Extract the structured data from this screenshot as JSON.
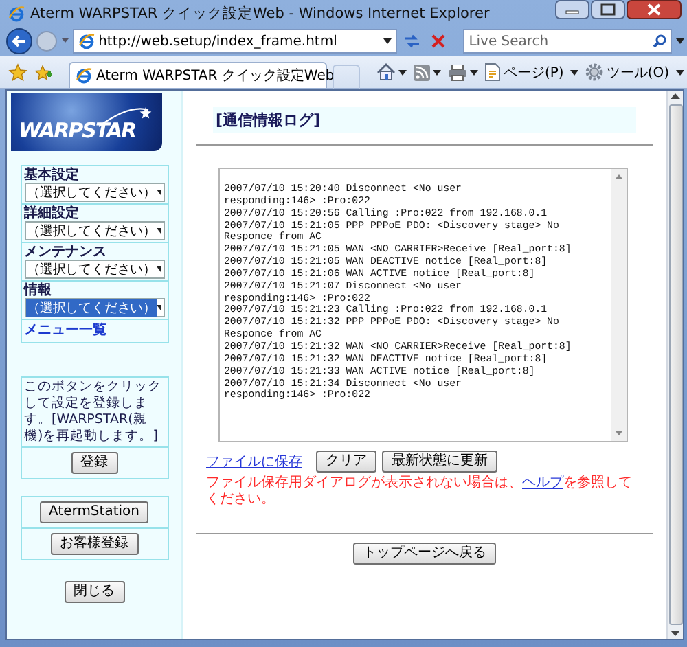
{
  "window": {
    "title": "Aterm WARPSTAR クイック設定Web - Windows Internet Explorer"
  },
  "address_bar": {
    "url": "http://web.setup/index_frame.html"
  },
  "search": {
    "placeholder": "Live Search"
  },
  "tab": {
    "title": "Aterm WARPSTAR クイック設定Web"
  },
  "command_bar": [
    {
      "kind": "home"
    },
    {
      "kind": "feeds"
    },
    {
      "kind": "print"
    },
    {
      "kind": "page",
      "label": "ページ(P)"
    },
    {
      "kind": "tools",
      "label": "ツール(O)"
    }
  ],
  "sidebar": {
    "logo": "WARPSTAR",
    "menus": [
      {
        "label": "基本設定",
        "value": "（選択してください）",
        "selected": false
      },
      {
        "label": "詳細設定",
        "value": "（選択してください）",
        "selected": false
      },
      {
        "label": "メンテナンス",
        "value": "（選択してください）",
        "selected": false
      },
      {
        "label": "情報",
        "value": "（選択してください）",
        "selected": true
      }
    ],
    "menu_list_link": "メニュー一覧",
    "register_note": "このボタンをクリックして設定を登録します。[WARPSTAR(親機)を再起動します。]",
    "register_button": "登録",
    "buttons": [
      "AtermStation",
      "お客様登録"
    ],
    "close_button": "閉じる"
  },
  "main": {
    "heading": "[通信情報ログ]",
    "log_lines": [
      "2007/07/10 15:20:40 Disconnect <No user",
      "responding:146> :Pro:022",
      "2007/07/10 15:20:56 Calling :Pro:022 from 192.168.0.1",
      "2007/07/10 15:21:05 PPP PPPoE PDO: <Discovery stage> No",
      "Responce from AC",
      "2007/07/10 15:21:05 WAN <NO CARRIER>Receive [Real_port:8]",
      "2007/07/10 15:21:05 WAN DEACTIVE notice [Real_port:8]",
      "2007/07/10 15:21:06 WAN ACTIVE notice [Real_port:8]",
      "2007/07/10 15:21:07 Disconnect <No user",
      "responding:146> :Pro:022",
      "2007/07/10 15:21:23 Calling :Pro:022 from 192.168.0.1",
      "2007/07/10 15:21:32 PPP PPPoE PDO: <Discovery stage> No",
      "Responce from AC",
      "2007/07/10 15:21:32 WAN <NO CARRIER>Receive [Real_port:8]",
      "2007/07/10 15:21:32 WAN DEACTIVE notice [Real_port:8]",
      "2007/07/10 15:21:33 WAN ACTIVE notice [Real_port:8]",
      "2007/07/10 15:21:34 Disconnect <No user",
      "responding:146> :Pro:022"
    ],
    "save_link": "ファイルに保存",
    "buttons": [
      "クリア",
      "最新状態に更新"
    ],
    "notice": {
      "before": "ファイル保存用ダイアログが表示されない場合は、",
      "link": "ヘルプ",
      "after": "を参照してください。"
    },
    "back_button": "トップページへ戻る"
  }
}
